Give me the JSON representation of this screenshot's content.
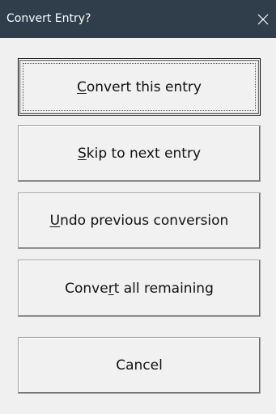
{
  "window": {
    "title": "Convert Entry?",
    "close_icon": "close-icon"
  },
  "buttons": [
    {
      "pre": "",
      "key": "C",
      "post": "onvert this entry"
    },
    {
      "pre": "",
      "key": "S",
      "post": "kip to next entry"
    },
    {
      "pre": "",
      "key": "U",
      "post": "ndo previous conversion"
    },
    {
      "pre": "Conve",
      "key": "r",
      "post": "t all remaining"
    },
    {
      "pre": "Cancel",
      "key": "",
      "post": ""
    }
  ],
  "colors": {
    "titlebar": "#2f3e4a",
    "dialog_background": "#f0f0f0",
    "button_face": "#f1f1f1"
  }
}
